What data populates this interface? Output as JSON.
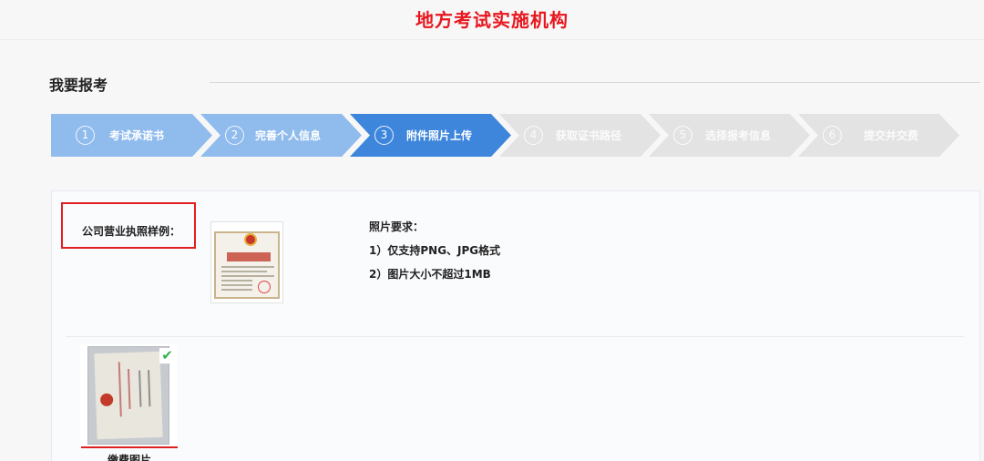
{
  "header": {
    "title": "地方考试实施机构"
  },
  "section": {
    "title": "我要报考"
  },
  "steps": [
    {
      "num": "1",
      "label": "考试承诺书",
      "state": "done"
    },
    {
      "num": "2",
      "label": "完善个人信息",
      "state": "done"
    },
    {
      "num": "3",
      "label": "附件照片上传",
      "state": "active"
    },
    {
      "num": "4",
      "label": "获取证书路径",
      "state": "todo"
    },
    {
      "num": "5",
      "label": "选择报考信息",
      "state": "todo"
    },
    {
      "num": "6",
      "label": "提交并交费",
      "state": "todo"
    }
  ],
  "sample": {
    "label": "公司营业执照样例："
  },
  "requirements": {
    "title": "照片要求：",
    "items": [
      "1）仅支持PNG、JPG格式",
      "2）图片大小不超过1MB"
    ]
  },
  "upload": {
    "caption": "缴费图片",
    "status_icon": "check-icon"
  }
}
